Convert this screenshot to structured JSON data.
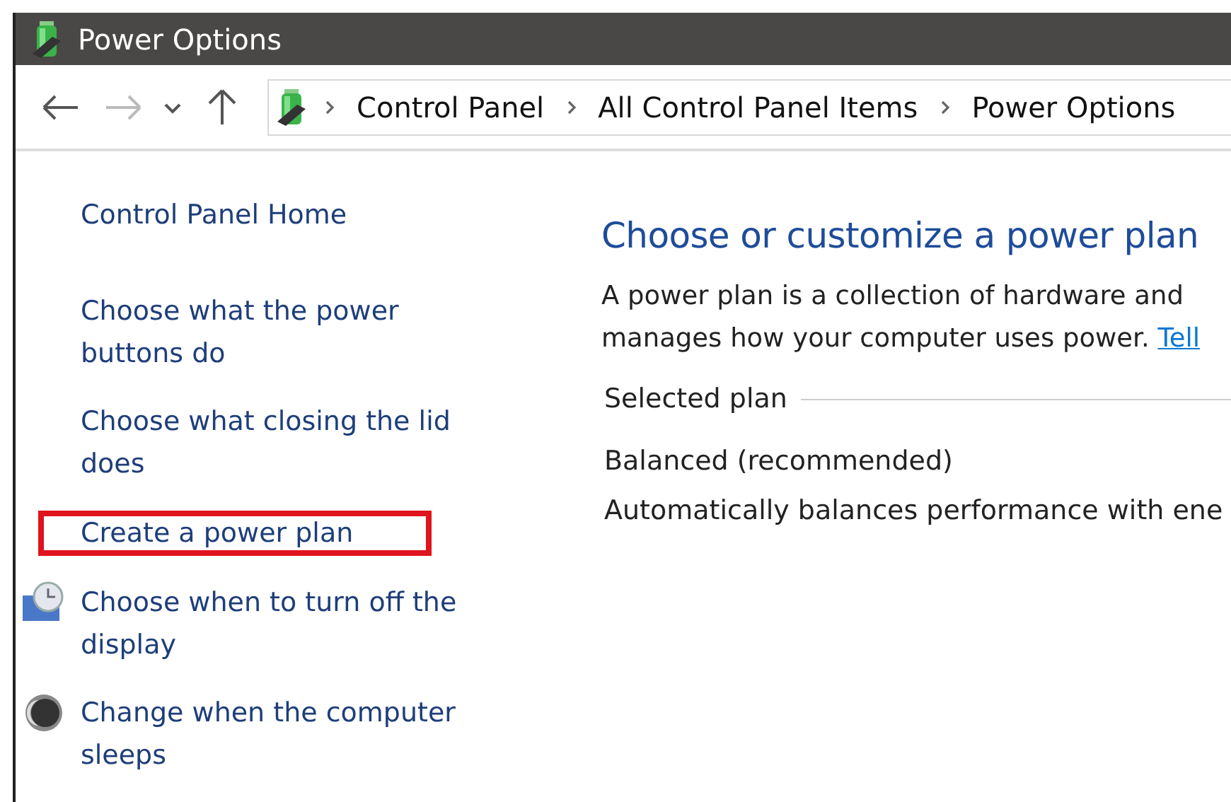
{
  "window": {
    "title": "Power Options"
  },
  "address_bar": {
    "breadcrumbs": [
      "Control Panel",
      "All Control Panel Items",
      "Power Options"
    ]
  },
  "sidebar": {
    "home": "Control Panel Home",
    "items": [
      {
        "label": "Choose what the power buttons do",
        "kind": "plain",
        "highlighted": false
      },
      {
        "label": "Choose what closing the lid does",
        "kind": "plain",
        "highlighted": false
      },
      {
        "label": "Create a power plan",
        "kind": "plain",
        "highlighted": true
      },
      {
        "label": "Choose when to turn off the display",
        "kind": "display",
        "highlighted": false
      },
      {
        "label": "Change when the computer sleeps",
        "kind": "sleep",
        "highlighted": false
      }
    ]
  },
  "content": {
    "heading": "Choose or customize a power plan",
    "description_lines": [
      "A power plan is a collection of hardware and",
      "manages how your computer uses power."
    ],
    "link": "Tell",
    "section": "Selected plan",
    "plan_name": "Balanced (recommended)",
    "plan_description": "Automatically balances performance with ene"
  }
}
